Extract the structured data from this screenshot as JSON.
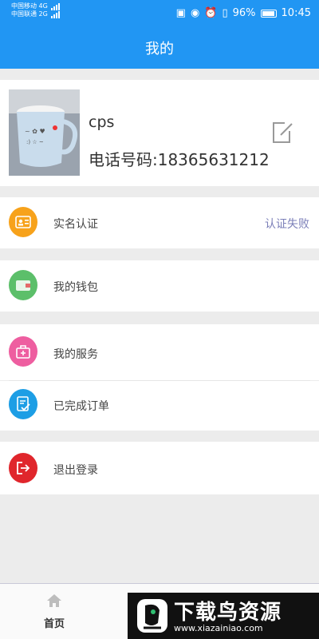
{
  "status": {
    "carrier1": "中国移动",
    "carrier2": "中国联通",
    "net1": "4G",
    "net2": "2G",
    "battery": "96%",
    "time": "10:45"
  },
  "header": {
    "title": "我的"
  },
  "profile": {
    "name": "cps",
    "phone": "电话号码:18365631212"
  },
  "menu": {
    "verify": {
      "label": "实名认证",
      "value": "认证失败",
      "icon": "id-card-icon",
      "color": "#f7a21b"
    },
    "wallet": {
      "label": "我的钱包",
      "icon": "wallet-icon",
      "color": "#5cbf6a"
    },
    "service": {
      "label": "我的服务",
      "icon": "service-bag-icon",
      "color": "#ee5ea0"
    },
    "orders": {
      "label": "已完成订单",
      "icon": "order-check-icon",
      "color": "#1d9ee5"
    },
    "logout": {
      "label": "退出登录",
      "icon": "logout-icon",
      "color": "#e0262c"
    }
  },
  "tabbar": {
    "home": "首页"
  },
  "watermark": {
    "title": "下载鸟资源",
    "url": "www.xiazainiao.com"
  }
}
